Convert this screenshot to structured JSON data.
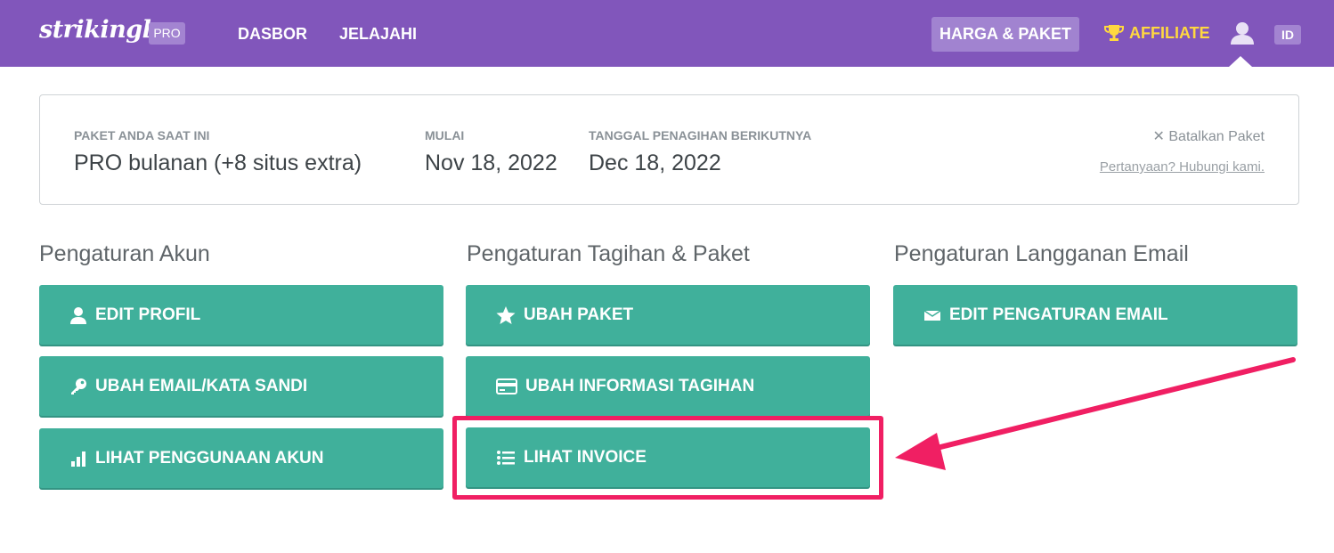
{
  "nav": {
    "logo": "strikingly",
    "plan_badge": "PRO",
    "links": [
      "DASBOR",
      "JELAJAHI"
    ],
    "pricing_button": "HARGA & PAKET",
    "affiliate": "AFFILIATE",
    "language": "ID",
    "colors": {
      "bar": "#8156bb",
      "affiliate": "#ffd83f"
    }
  },
  "plan": {
    "current_label": "PAKET ANDA SAAT INI",
    "current_value": "PRO bulanan (+8 situs extra)",
    "start_label": "MULAI",
    "start_value": "Nov 18, 2022",
    "next_billing_label": "TANGGAL PENAGIHAN BERIKUTNYA",
    "next_billing_value": "Dec 18, 2022",
    "cancel_link": "Batalkan Paket",
    "contact_link": "Pertanyaan? Hubungi kami."
  },
  "sections": {
    "account": {
      "title": "Pengaturan Akun",
      "buttons": [
        "EDIT PROFIL",
        "UBAH EMAIL/KATA SANDI",
        "LIHAT PENGGUNAAN AKUN"
      ]
    },
    "billing": {
      "title": "Pengaturan Tagihan & Paket",
      "buttons": [
        "UBAH PAKET",
        "UBAH INFORMASI TAGIHAN",
        "LIHAT INVOICE"
      ]
    },
    "email": {
      "title": "Pengaturan Langganan Email",
      "buttons": [
        "EDIT PENGATURAN EMAIL"
      ]
    }
  },
  "colors": {
    "button": "#40b09b",
    "highlight": "#f01f63"
  }
}
